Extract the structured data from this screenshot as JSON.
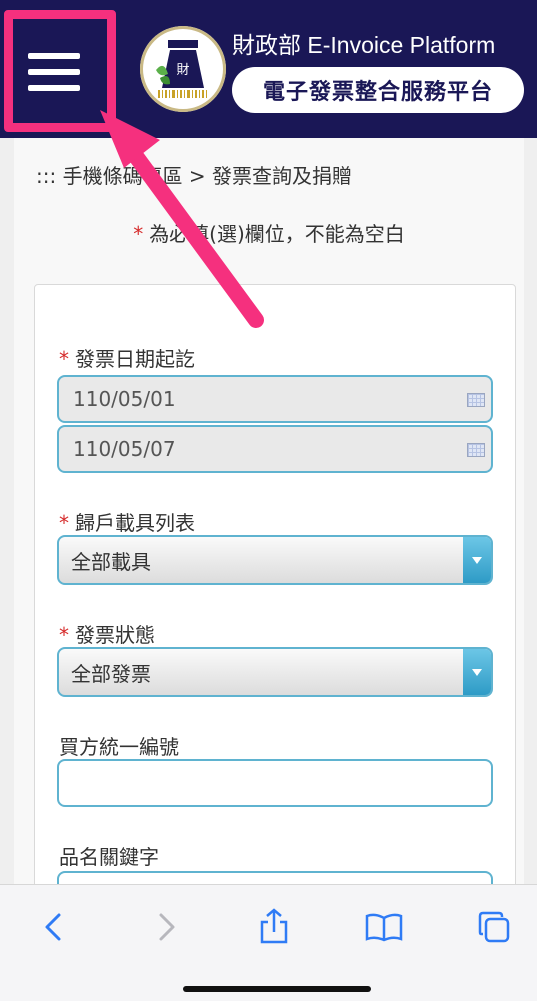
{
  "header": {
    "title_en": "財政部 E-Invoice Platform",
    "title_zh": "電子發票整合服務平台"
  },
  "breadcrumb": "::: 手機條碼專區 > 發票查詢及捐贈",
  "required_note": "為必填(選)欄位，不能為空白",
  "required_mark": "*",
  "form": {
    "date_range": {
      "label": "發票日期起訖",
      "start": "110/05/01",
      "end": "110/05/07"
    },
    "carrier": {
      "label": "歸戶載具列表",
      "selected": "全部載具"
    },
    "status": {
      "label": "發票狀態",
      "selected": "全部發票"
    },
    "buyer_id": {
      "label": "買方統一編號",
      "value": ""
    },
    "keyword": {
      "label": "品名關鍵字",
      "value": ""
    }
  },
  "colors": {
    "header_bg": "#1a1756",
    "highlight": "#f5307e",
    "required": "#d62b2b",
    "input_border": "#5fb3d0",
    "toolbar_icon": "#2f7bf5"
  },
  "toolbar": {
    "icons": [
      "back-icon",
      "forward-icon",
      "share-icon",
      "bookmarks-icon",
      "tabs-icon"
    ]
  }
}
